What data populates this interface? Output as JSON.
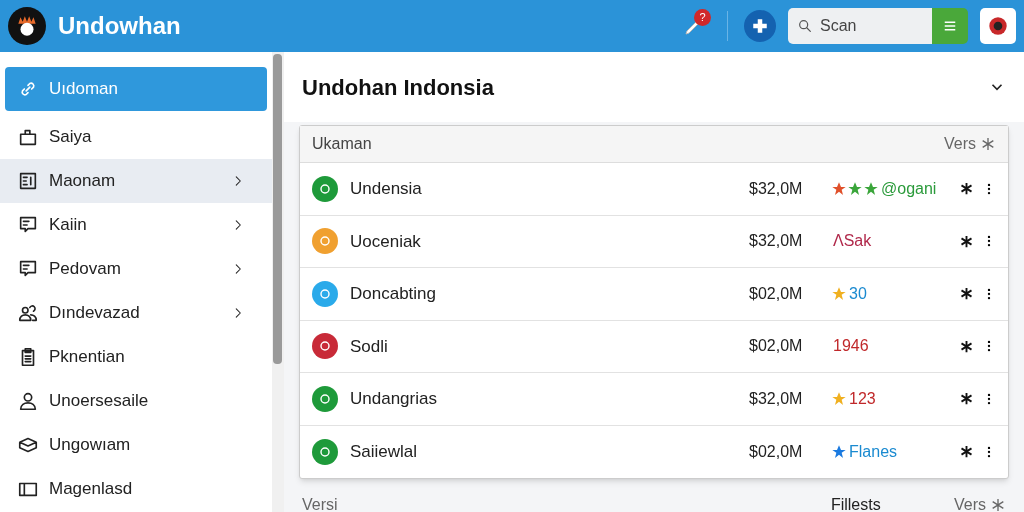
{
  "app": {
    "title": "Undowhan",
    "search": {
      "placeholder": "Scan"
    },
    "notification_badge": "?"
  },
  "sidebar": {
    "items": [
      {
        "label": "Uıdoman",
        "selected": true,
        "hovered": false,
        "expandable": false
      },
      {
        "label": "Saiya",
        "selected": false,
        "hovered": false,
        "expandable": false
      },
      {
        "label": "Maonam",
        "selected": false,
        "hovered": true,
        "expandable": true
      },
      {
        "label": "Kaiin",
        "selected": false,
        "hovered": false,
        "expandable": true
      },
      {
        "label": "Pedovam",
        "selected": false,
        "hovered": false,
        "expandable": true
      },
      {
        "label": "Dındevazad",
        "selected": false,
        "hovered": false,
        "expandable": true
      },
      {
        "label": "Pknentian",
        "selected": false,
        "hovered": false,
        "expandable": false
      },
      {
        "label": "Unoersesaile",
        "selected": false,
        "hovered": false,
        "expandable": false
      },
      {
        "label": "Ungowıam",
        "selected": false,
        "hovered": false,
        "expandable": false
      },
      {
        "label": "Magenlasd",
        "selected": false,
        "hovered": false,
        "expandable": false
      }
    ]
  },
  "main": {
    "heading": "Undohan Indonsia",
    "table": {
      "header": {
        "title": "Ukaman",
        "action": "Vers"
      },
      "rows": [
        {
          "name": "Undensia",
          "color": "#1e9a3a",
          "amount": "$32,0M",
          "tag": {
            "text": "@ogani",
            "color": "#2a9a3a",
            "star_marks": [
              {
                "color": "#e0502a"
              },
              {
                "color": "#3aa53a"
              },
              {
                "color": "#3aa53a"
              }
            ]
          }
        },
        {
          "name": "Uoceniak",
          "color": "#f0a030",
          "amount": "$32,0M",
          "tag": {
            "text": "ΛSak",
            "color": "#b0284a"
          }
        },
        {
          "name": "Doncabting",
          "color": "#2aaaea",
          "amount": "$02,0M",
          "tag": {
            "text": "30",
            "color": "#1a8ad0",
            "star_marks": [
              {
                "color": "#f0b020"
              }
            ]
          }
        },
        {
          "name": "Sodli",
          "color": "#c82a38",
          "amount": "$02,0M",
          "tag": {
            "text": "1946",
            "color": "#c0282a"
          }
        },
        {
          "name": "Undangrias",
          "color": "#1e9a3a",
          "amount": "$32,0M",
          "tag": {
            "text": "123",
            "color": "#c0282a",
            "star_marks": [
              {
                "color": "#f0b020"
              }
            ]
          }
        },
        {
          "name": "Saiiewlal",
          "color": "#1e9a3a",
          "amount": "$02,0M",
          "tag": {
            "text": "Flanes",
            "color": "#1a8ad0",
            "star_marks": [
              {
                "color": "#1a7ae0"
              }
            ]
          }
        }
      ]
    },
    "footer": {
      "left": "Versi",
      "center": "Fillests",
      "right": "Vers"
    }
  }
}
